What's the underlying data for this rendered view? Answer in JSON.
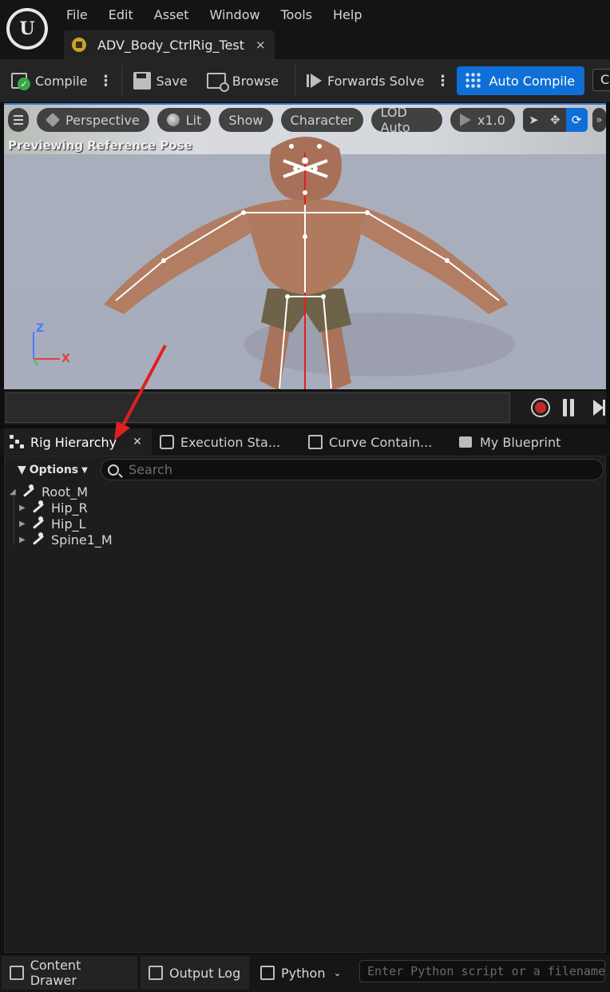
{
  "menu": [
    "File",
    "Edit",
    "Asset",
    "Window",
    "Tools",
    "Help"
  ],
  "document_tab": {
    "title": "ADV_Body_CtrlRig_Test",
    "close": "×"
  },
  "toolbar": {
    "compile": "Compile",
    "save": "Save",
    "browse": "Browse",
    "forwards_solve": "Forwards Solve",
    "auto_compile": "Auto Compile",
    "clipped": "C"
  },
  "viewport": {
    "menu_icon": "hamburger-icon",
    "perspective": "Perspective",
    "lit": "Lit",
    "show": "Show",
    "character": "Character",
    "lod": "LOD Auto",
    "speed": "x1.0",
    "status": "Previewing Reference Pose",
    "axis": {
      "z": "Z",
      "x": "X"
    }
  },
  "panel_tabs": [
    {
      "label": "Rig Hierarchy",
      "icon": "hierarchy-icon",
      "active": true
    },
    {
      "label": "Execution Sta...",
      "icon": "execution-stack-icon",
      "active": false
    },
    {
      "label": "Curve Contain...",
      "icon": "curve-icon",
      "active": false
    },
    {
      "label": "My Blueprint",
      "icon": "book-icon",
      "active": false
    }
  ],
  "hierarchy": {
    "options": "Options",
    "search_placeholder": "Search",
    "items": [
      {
        "label": "Root_M",
        "expanded": true,
        "depth": 0
      },
      {
        "label": "Hip_R",
        "expanded": false,
        "depth": 1
      },
      {
        "label": "Hip_L",
        "expanded": false,
        "depth": 1
      },
      {
        "label": "Spine1_M",
        "expanded": false,
        "depth": 1
      }
    ]
  },
  "statusbar": {
    "content_drawer": "Content Drawer",
    "output_log": "Output Log",
    "python": "Python",
    "python_placeholder": "Enter Python script or a filename"
  },
  "colors": {
    "accent": "#0e6fd6",
    "annotation_arrow": "#e02020",
    "axis_x": "#e04040",
    "axis_z": "#4a7bff",
    "axis_y": "#3cc43c"
  }
}
